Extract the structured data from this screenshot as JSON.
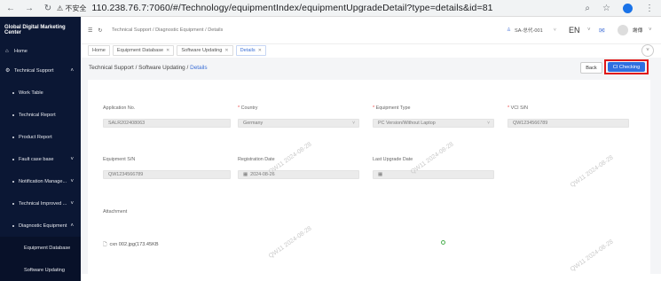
{
  "browser": {
    "security_label": "不安全",
    "url": "110.238.76.7:7060/#/Technology/equipmentIndex/equipmentUpgradeDetail?type=details&id=81",
    "profile_initial": "●"
  },
  "sidebar": {
    "brand": "Global Digital Marketing Center",
    "items": [
      {
        "label": "Home"
      },
      {
        "label": "Technical Support"
      },
      {
        "label": "Work Table"
      },
      {
        "label": "Technical Report"
      },
      {
        "label": "Product Report"
      },
      {
        "label": "Fault case base"
      },
      {
        "label": "Notification Manage..."
      },
      {
        "label": "Technical Improved ..."
      },
      {
        "label": "Diagnostic Equipment"
      },
      {
        "label": "Equipment Database"
      },
      {
        "label": "Software Updating"
      }
    ]
  },
  "header": {
    "breadcrumb": "Technical Support  /  Diagnostic Equipment  /  Details",
    "user_code": "SA-总代-001",
    "language": "EN",
    "user_name": "謝傳"
  },
  "tabs": [
    {
      "label": "Home"
    },
    {
      "label": "Equipment Database"
    },
    {
      "label": "Software Updating"
    },
    {
      "label": "Details"
    }
  ],
  "page": {
    "crumb_1": "Technical Support",
    "crumb_2": "Software Updating",
    "crumb_3": "Details",
    "back_label": "Back",
    "check_label": "CI Checking"
  },
  "form": {
    "application_no": {
      "label": "Application No.",
      "value": "SALR202408063"
    },
    "country": {
      "label": "Country",
      "value": "Germany"
    },
    "equipment_type": {
      "label": "Equipment Type",
      "value": "PC Version/Without Laptop"
    },
    "vci_sn": {
      "label": "VCI S/N",
      "value": "QW1234566789"
    },
    "equipment_sn": {
      "label": "Equipment S/N",
      "value": "QW1234566789"
    },
    "registration_date": {
      "label": "Registration Date",
      "value": "2024-08-26"
    },
    "last_upgrade_date": {
      "label": "Last Upgrade Date",
      "value": ""
    },
    "attachment_label": "Attachment",
    "attachment_file": "cxn 002.jpg(173.45KB"
  },
  "watermark": "QW11 2024-08-28"
}
